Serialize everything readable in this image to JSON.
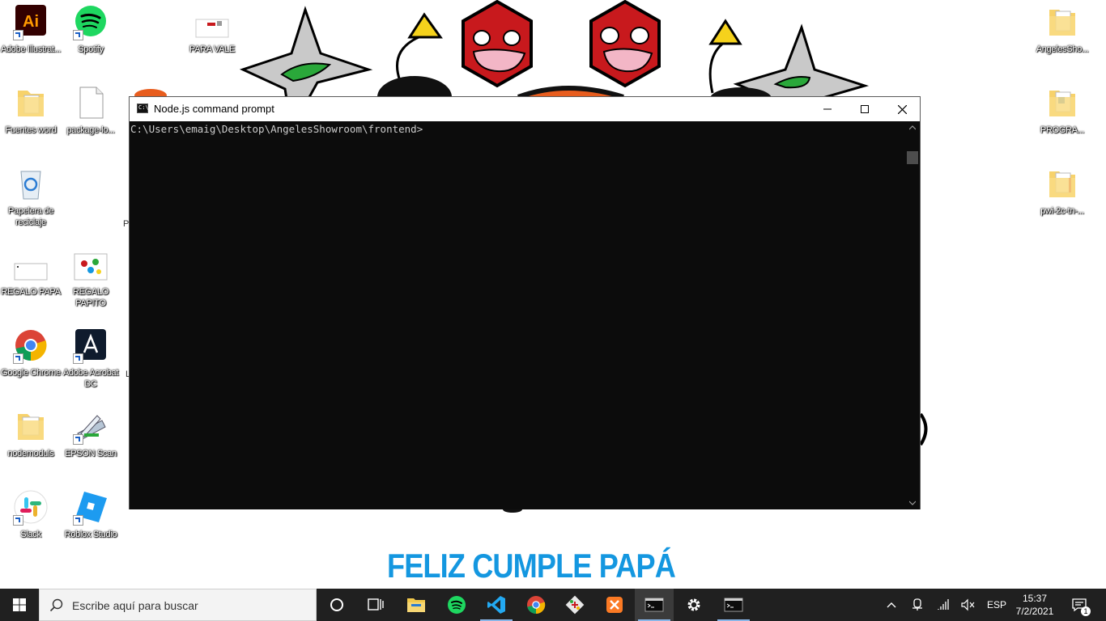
{
  "desktop": {
    "icons": [
      {
        "label": "Adobe Illustrat...",
        "icon": "adobe-illustrator-icon",
        "shortcut": true
      },
      {
        "label": "Spotify",
        "icon": "spotify-icon",
        "shortcut": true
      },
      {
        "label": "PARA VALE",
        "icon": "image-file-icon",
        "shortcut": false
      },
      {
        "label": "Fuentes word",
        "icon": "folder-icon",
        "shortcut": false
      },
      {
        "label": "package-lo...",
        "icon": "file-icon",
        "shortcut": false
      },
      {
        "label": "Papelera de reciclaje",
        "icon": "recycle-bin-icon",
        "shortcut": false
      },
      {
        "label": "REGALO PAPA",
        "icon": "image-file-icon",
        "shortcut": false
      },
      {
        "label": "REGALO PAPITO",
        "icon": "image-file-icon",
        "shortcut": false
      },
      {
        "label": "Google Chrome",
        "icon": "chrome-icon",
        "shortcut": true
      },
      {
        "label": "Adobe Acrobat DC",
        "icon": "acrobat-icon",
        "shortcut": true
      },
      {
        "label": "nodemoduls",
        "icon": "folder-icon",
        "shortcut": false
      },
      {
        "label": "EPSON Scan",
        "icon": "scanner-icon",
        "shortcut": true
      },
      {
        "label": "Slack",
        "icon": "slack-icon",
        "shortcut": true
      },
      {
        "label": "Roblox Studio",
        "icon": "roblox-studio-icon",
        "shortcut": true
      },
      {
        "label": "AngelesSho...",
        "icon": "folder-icon",
        "shortcut": false
      },
      {
        "label": "PROGRA...",
        "icon": "folder-icon",
        "shortcut": false
      },
      {
        "label": "pwi-2c-tn-...",
        "icon": "folder-icon",
        "shortcut": false
      }
    ],
    "wallpaper_text": "FELIZ CUMPLE PAPÁ"
  },
  "console": {
    "title": "Node.js command prompt",
    "prompt_text": "C:\\Users\\emaig\\Desktop\\AngelesShowroom\\frontend>",
    "background": "#0c0c0c",
    "text_color": "#cccccc"
  },
  "taskbar": {
    "search_placeholder": "Escribe aquí para buscar",
    "apps": [
      {
        "name": "task-view-cortana",
        "icon": "cortana-icon"
      },
      {
        "name": "task-view",
        "icon": "task-view-icon"
      },
      {
        "name": "file-explorer",
        "icon": "file-explorer-icon"
      },
      {
        "name": "spotify",
        "icon": "spotify-icon"
      },
      {
        "name": "vscode",
        "icon": "vscode-icon"
      },
      {
        "name": "chrome",
        "icon": "chrome-icon"
      },
      {
        "name": "git-gui",
        "icon": "git-icon"
      },
      {
        "name": "xampp",
        "icon": "xampp-icon"
      },
      {
        "name": "nodejs-prompt",
        "icon": "terminal-icon",
        "active": true
      },
      {
        "name": "settings",
        "icon": "gear-icon"
      },
      {
        "name": "command-prompt",
        "icon": "terminal-icon"
      }
    ],
    "language": "ESP",
    "time": "15:37",
    "date": "7/2/2021",
    "notification_count": "1"
  },
  "colors": {
    "banner": "#1497e0",
    "taskbar": "#202020",
    "hex_red": "#c8191d"
  }
}
